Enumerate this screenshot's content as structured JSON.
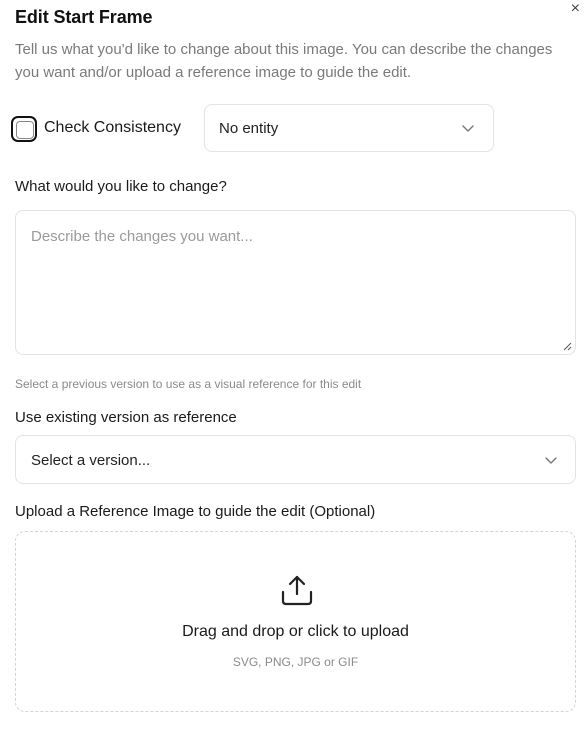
{
  "dialog": {
    "title": "Edit Start Frame",
    "close_icon": "×",
    "description": "Tell us what you'd like to change about this image. You can describe the changes you want and/or upload a reference image to guide the edit."
  },
  "consistency": {
    "checkbox_label": "Check Consistency",
    "checked": false,
    "entity_select_value": "No entity"
  },
  "change": {
    "label": "What would you like to change?",
    "placeholder": "Describe the changes you want..."
  },
  "version": {
    "hint": "Select a previous version to use as a visual reference for this edit",
    "label": "Use existing version as reference",
    "select_value": "Select a version..."
  },
  "upload": {
    "label": "Upload a Reference Image to guide the edit (Optional)",
    "title": "Drag and drop or click to upload",
    "formats": "SVG, PNG, JPG or GIF"
  },
  "icons": {
    "close": "close-icon",
    "chevron": "chevron-down-icon",
    "upload": "upload-icon",
    "resize": "resize-handle-icon"
  }
}
